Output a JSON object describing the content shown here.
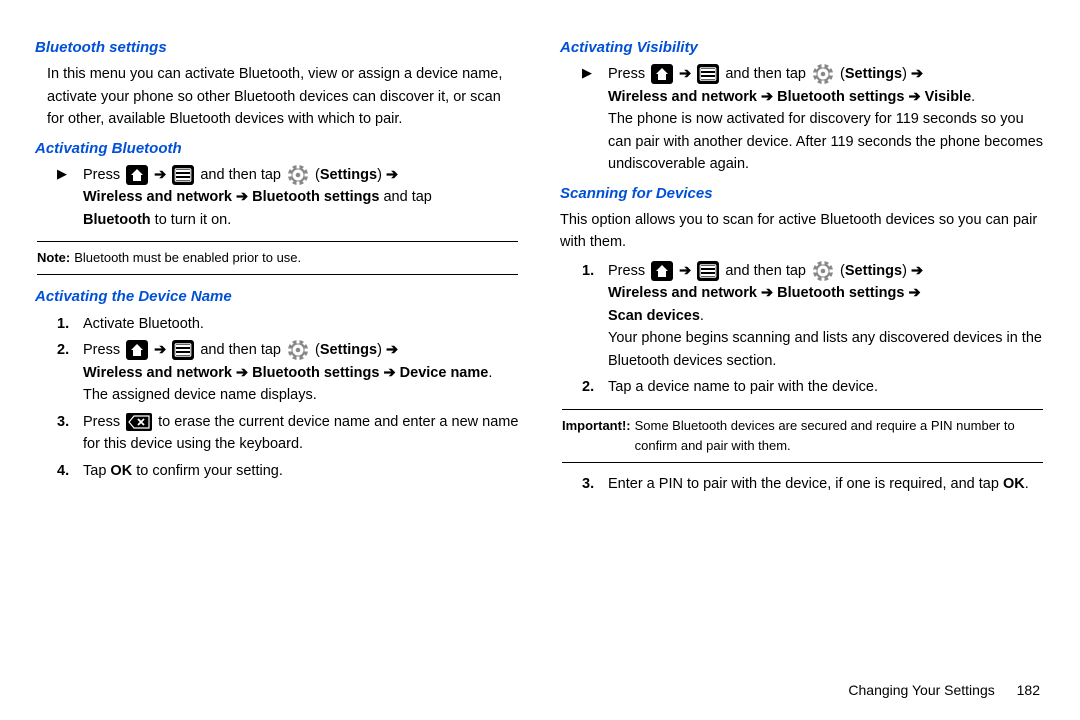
{
  "left": {
    "h1": "Bluetooth settings",
    "intro": "In this menu you can activate Bluetooth, view or assign a device name, activate your phone so other Bluetooth devices can discover it, or scan for other, available Bluetooth devices with which to pair.",
    "h2a": "Activating Bluetooth",
    "a_press": "Press ",
    "a_andtap": " and then tap ",
    "a_settings_open": " (",
    "a_settings": "Settings",
    "a_settings_close": ") ",
    "a_line2_1": "Wireless and network ",
    "a_line2_2": " Bluetooth settings",
    "a_line2_tail": " and tap ",
    "a_line3_1": "Bluetooth",
    "a_line3_2": " to turn it on.",
    "note_label": "Note:",
    "note_text": " Bluetooth must be enabled prior to use.",
    "h2b": "Activating the Device Name",
    "b1": "Activate Bluetooth.",
    "b2_press": "Press ",
    "b2_andtap": " and then tap ",
    "b2_settings": "Settings",
    "b2_line2_1": "Wireless and network ",
    "b2_line2_2": " Bluetooth settings ",
    "b2_line2_3": " Device name",
    "b2_line3": "The assigned device name displays.",
    "b3_1": "Press ",
    "b3_2": " to erase the current device name and enter a new name for this device using the keyboard.",
    "b4_1": "Tap ",
    "b4_ok": "OK",
    "b4_2": " to confirm your setting."
  },
  "right": {
    "h2c": "Activating Visibility",
    "c_press": "Press ",
    "c_andtap": " and then tap ",
    "c_settings": "Settings",
    "c_line2_1": "Wireless and network ",
    "c_line2_2": " Bluetooth settings ",
    "c_line2_3": " Visible",
    "c_para": "The phone is now activated for discovery for 119 seconds so you can pair with another device. After 119 seconds the phone becomes undiscoverable again.",
    "h2d": "Scanning for Devices",
    "d_intro": "This option allows you to scan for active Bluetooth devices so you can pair with them.",
    "d1_press": "Press ",
    "d1_andtap": " and then tap ",
    "d1_settings": "Settings",
    "d1_line2_1": "Wireless and network ",
    "d1_line2_2": " Bluetooth settings ",
    "d1_line3_1": "Scan devices",
    "d1_para": "Your phone begins scanning and lists any discovered devices in the Bluetooth devices section.",
    "d2": "Tap a device name to pair with the device.",
    "imp_label": "Important!:",
    "imp_text": " Some Bluetooth devices are secured and require a PIN number to confirm and pair with them.",
    "d3_1": "Enter a PIN to pair with the device, if one is required, and tap ",
    "d3_ok": "OK",
    "d3_2": "."
  },
  "footer": {
    "section": "Changing Your Settings",
    "page": "182"
  },
  "glyphs": {
    "arrow": "➔",
    "tri": "▶"
  }
}
